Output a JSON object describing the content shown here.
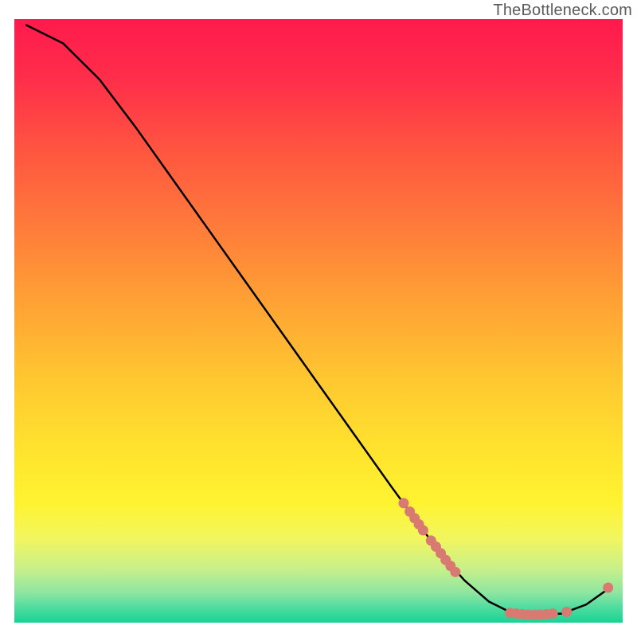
{
  "watermark": "TheBottleneck.com",
  "chart_data": {
    "type": "line",
    "title": "",
    "xlabel": "",
    "ylabel": "",
    "xlim": [
      0,
      100
    ],
    "ylim": [
      0,
      100
    ],
    "grid": false,
    "curve": [
      {
        "x": 2.0,
        "y": 99.0
      },
      {
        "x": 8.0,
        "y": 96.0
      },
      {
        "x": 14.0,
        "y": 90.0
      },
      {
        "x": 20.0,
        "y": 82.0
      },
      {
        "x": 26.0,
        "y": 73.5
      },
      {
        "x": 32.0,
        "y": 65.0
      },
      {
        "x": 38.0,
        "y": 56.5
      },
      {
        "x": 44.0,
        "y": 48.0
      },
      {
        "x": 50.0,
        "y": 39.5
      },
      {
        "x": 56.0,
        "y": 31.0
      },
      {
        "x": 62.0,
        "y": 22.5
      },
      {
        "x": 66.0,
        "y": 17.0
      },
      {
        "x": 70.0,
        "y": 11.5
      },
      {
        "x": 74.0,
        "y": 7.0
      },
      {
        "x": 78.0,
        "y": 3.5
      },
      {
        "x": 82.0,
        "y": 1.5
      },
      {
        "x": 86.0,
        "y": 1.3
      },
      {
        "x": 90.0,
        "y": 1.5
      },
      {
        "x": 94.0,
        "y": 3.0
      },
      {
        "x": 97.5,
        "y": 5.5
      }
    ],
    "marker_groups": [
      {
        "points": [
          {
            "x": 64.0,
            "y": 19.8
          },
          {
            "x": 65.0,
            "y": 18.4
          },
          {
            "x": 65.8,
            "y": 17.3
          },
          {
            "x": 66.5,
            "y": 16.3
          },
          {
            "x": 67.2,
            "y": 15.3
          },
          {
            "x": 68.5,
            "y": 13.6
          },
          {
            "x": 69.3,
            "y": 12.6
          },
          {
            "x": 70.1,
            "y": 11.5
          },
          {
            "x": 70.9,
            "y": 10.4
          },
          {
            "x": 71.7,
            "y": 9.4
          },
          {
            "x": 72.5,
            "y": 8.4
          }
        ]
      },
      {
        "points": [
          {
            "x": 81.5,
            "y": 1.6
          },
          {
            "x": 82.5,
            "y": 1.5
          },
          {
            "x": 83.5,
            "y": 1.4
          },
          {
            "x": 84.5,
            "y": 1.3
          },
          {
            "x": 85.5,
            "y": 1.3
          },
          {
            "x": 86.5,
            "y": 1.3
          },
          {
            "x": 87.5,
            "y": 1.4
          },
          {
            "x": 88.5,
            "y": 1.5
          },
          {
            "x": 90.8,
            "y": 1.8
          }
        ]
      },
      {
        "points": [
          {
            "x": 97.6,
            "y": 5.8
          }
        ]
      }
    ],
    "gradient_stops": [
      {
        "offset": 0.0,
        "color": "#ff1a4d"
      },
      {
        "offset": 0.1,
        "color": "#ff2e4a"
      },
      {
        "offset": 0.22,
        "color": "#ff5640"
      },
      {
        "offset": 0.35,
        "color": "#ff7d3a"
      },
      {
        "offset": 0.48,
        "color": "#ffa534"
      },
      {
        "offset": 0.6,
        "color": "#ffc830"
      },
      {
        "offset": 0.72,
        "color": "#ffe42e"
      },
      {
        "offset": 0.8,
        "color": "#fff330"
      },
      {
        "offset": 0.86,
        "color": "#f2f65e"
      },
      {
        "offset": 0.91,
        "color": "#c9f08a"
      },
      {
        "offset": 0.95,
        "color": "#8ee6a0"
      },
      {
        "offset": 0.975,
        "color": "#4fdca0"
      },
      {
        "offset": 1.0,
        "color": "#18d394"
      }
    ],
    "marker_color": "#d97a72",
    "curve_color": "#000000"
  }
}
